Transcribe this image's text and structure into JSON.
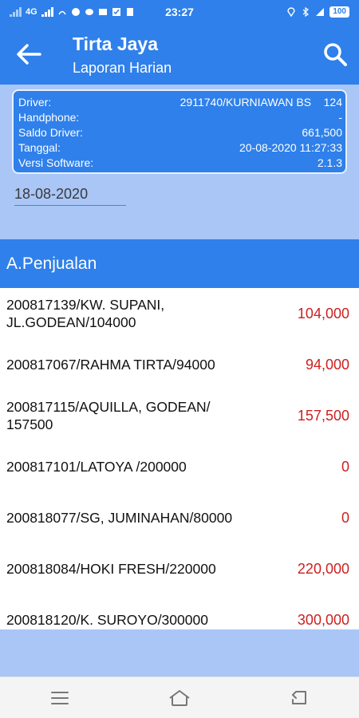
{
  "status_bar": {
    "network": "4G",
    "time": "23:27",
    "battery": "100",
    "network_right": "4G"
  },
  "app_bar": {
    "title": "Tirta Jaya",
    "subtitle": "Laporan Harian"
  },
  "info": {
    "rows": [
      {
        "label": "Driver:",
        "value": "2911740/KURNIAWAN BS    124"
      },
      {
        "label": "Handphone:",
        "value": "-"
      },
      {
        "label": "Saldo Driver:",
        "value": "661,500"
      },
      {
        "label": "Tanggal:",
        "value": "20-08-2020 11:27:33"
      },
      {
        "label": "Versi Software:",
        "value": "2.1.3"
      }
    ]
  },
  "date_filter": {
    "value": "18-08-2020"
  },
  "section": {
    "title": "A.Penjualan"
  },
  "sales": [
    {
      "desc": "200817139/KW. SUPANI, JL.GODEAN/104000",
      "amount": "104,000"
    },
    {
      "desc": "200817067/RAHMA TIRTA/94000",
      "amount": "94,000"
    },
    {
      "desc": "200817115/AQUILLA, GODEAN/ 157500",
      "amount": "157,500"
    },
    {
      "desc": "200817101/LATOYA /200000",
      "amount": "0"
    },
    {
      "desc": "200818077/SG, JUMINAHAN/80000",
      "amount": "0"
    },
    {
      "desc": "200818084/HOKI FRESH/220000",
      "amount": "220,000"
    },
    {
      "desc": "200818120/K. SUROYO/300000",
      "amount": "300,000"
    }
  ],
  "colors": {
    "primary": "#2f80ea",
    "light": "#a9c6f6",
    "amount": "#cc1f1f"
  },
  "icons": {
    "back": "arrow-left-icon",
    "search": "search-icon",
    "menu": "menu-icon",
    "home": "home-icon",
    "return": "back-nav-icon"
  }
}
